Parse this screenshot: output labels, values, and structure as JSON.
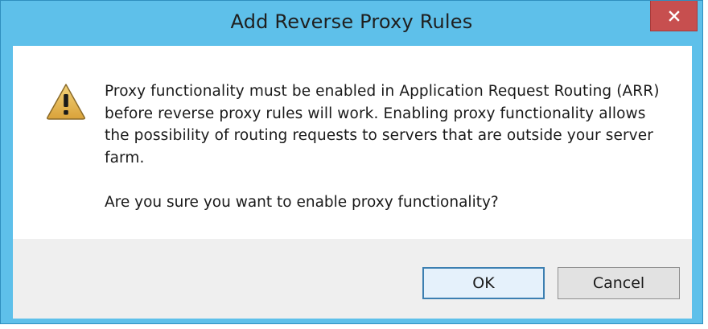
{
  "dialog": {
    "title": "Add Reverse Proxy Rules",
    "close_icon": "close-icon",
    "warning_icon": "warning-icon",
    "message": "Proxy functionality must be enabled in Application Request Routing (ARR) before reverse proxy rules will work. Enabling proxy functionality allows the possibility of routing requests to servers that are outside your server farm.",
    "question": "Are you sure you want to enable proxy functionality?",
    "buttons": {
      "ok": "OK",
      "cancel": "Cancel"
    },
    "colors": {
      "frame": "#5ec0ea",
      "close_button": "#c74f4f",
      "footer": "#efefef",
      "warning_fill": "#e8b94a"
    }
  }
}
